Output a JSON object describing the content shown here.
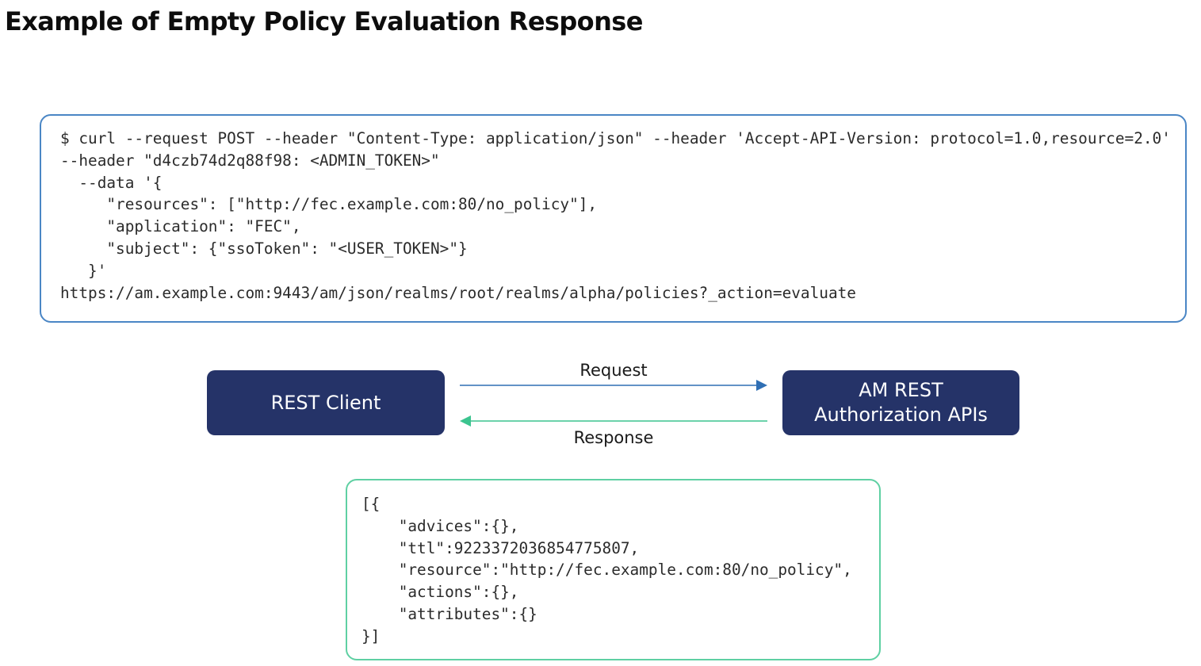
{
  "title": "Example of Empty Policy Evaluation Response",
  "request_code": [
    "$ curl --request POST --header \"Content-Type: application/json\" --header 'Accept-API-Version: protocol=1.0,resource=2.0'",
    "--header \"d4czb74d2q88f98: <ADMIN_TOKEN>\"",
    "  --data '{",
    "     \"resources\": [\"http://fec.example.com:80/no_policy\"],",
    "     \"application\": \"FEC\",",
    "     \"subject\": {\"ssoToken\": \"<USER_TOKEN>\"}",
    "   }'",
    "https://am.example.com:9443/am/json/realms/root/realms/alpha/policies?_action=evaluate"
  ],
  "diagram": {
    "client": {
      "label": "REST Client"
    },
    "server": {
      "label_line1": "AM REST",
      "label_line2": "Authorization APIs"
    },
    "request_label": "Request",
    "response_label": "Response",
    "colors": {
      "node_fill": "#253368",
      "request_arrow": "#2f6fb4",
      "response_arrow": "#3cc48f",
      "request_box_border": "#4a86c5",
      "response_box_border": "#5fd0a3"
    }
  },
  "response_code": [
    "[{",
    "    \"advices\":{},",
    "    \"ttl\":9223372036854775807,",
    "    \"resource\":\"http://fec.example.com:80/no_policy\",",
    "    \"actions\":{},",
    "    \"attributes\":{}",
    "}]"
  ]
}
